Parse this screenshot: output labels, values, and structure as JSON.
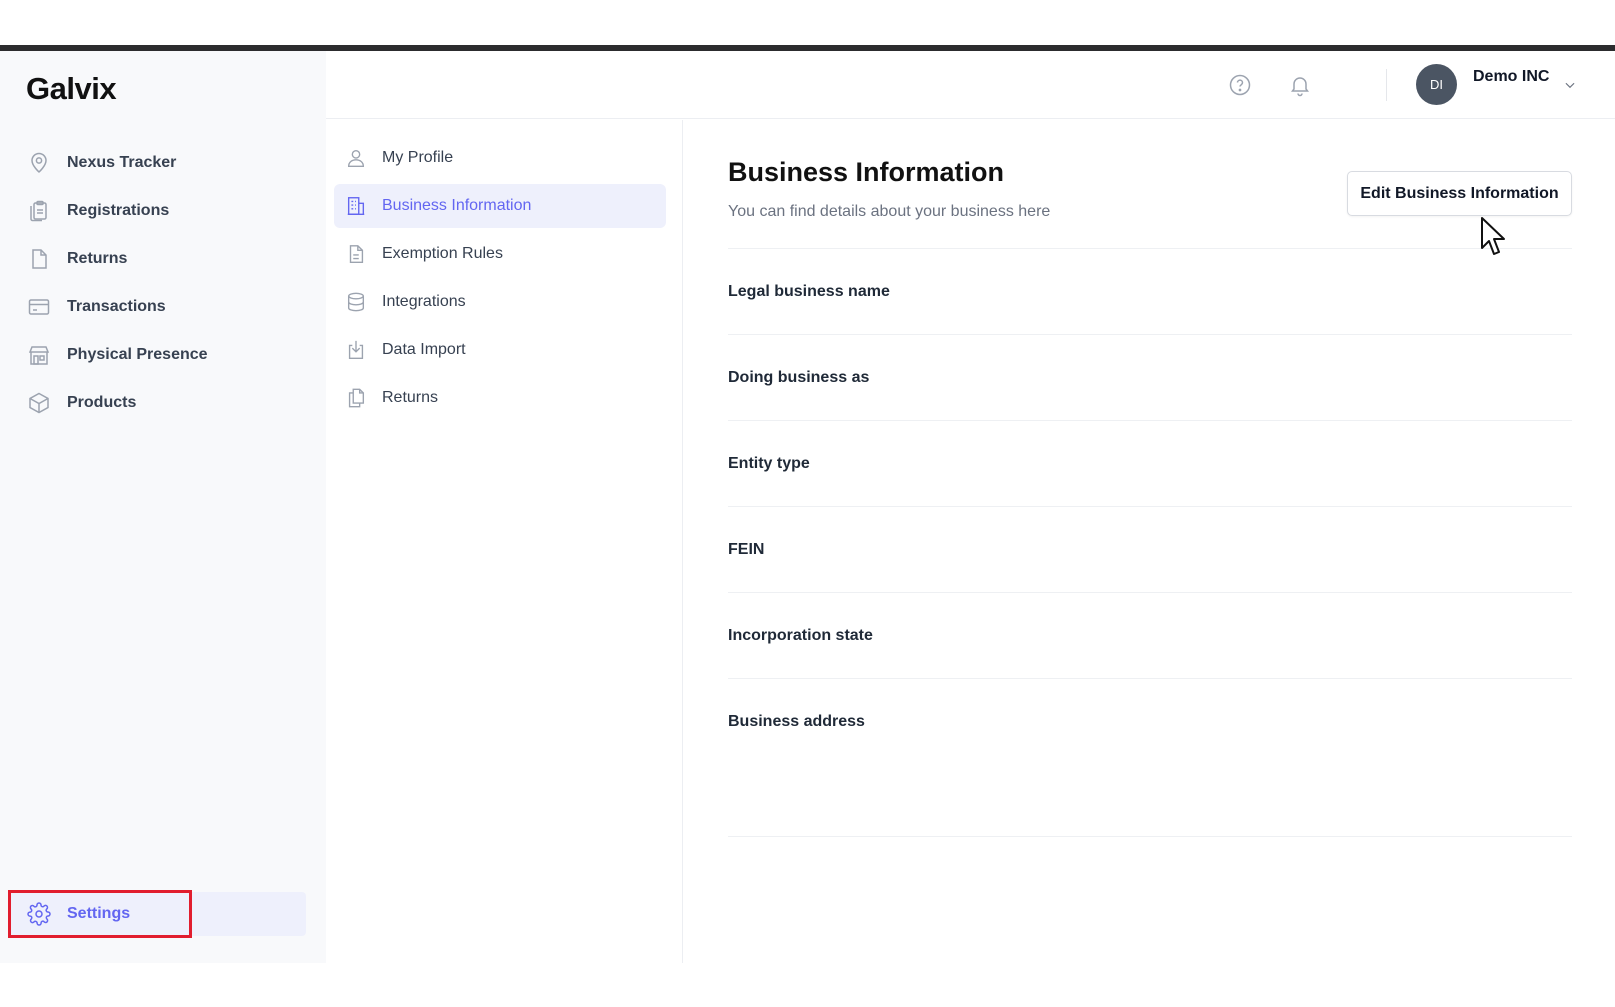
{
  "app": {
    "logo": "Galvix"
  },
  "sidebar": {
    "items": [
      {
        "label": "Nexus Tracker",
        "icon": "map-pin-icon"
      },
      {
        "label": "Registrations",
        "icon": "clipboard-icon"
      },
      {
        "label": "Returns",
        "icon": "document-icon"
      },
      {
        "label": "Transactions",
        "icon": "credit-card-icon"
      },
      {
        "label": "Physical Presence",
        "icon": "building-icon"
      },
      {
        "label": "Products",
        "icon": "box-icon"
      }
    ],
    "settings": {
      "label": "Settings",
      "icon": "gear-icon"
    }
  },
  "header": {
    "help_icon": "help-circle-icon",
    "bell_icon": "bell-icon",
    "avatar_initials": "DI",
    "company_name": "Demo INC"
  },
  "subnav": {
    "items": [
      {
        "label": "My Profile",
        "icon": "user-icon"
      },
      {
        "label": "Business Information",
        "icon": "office-building-icon",
        "active": true
      },
      {
        "label": "Exemption Rules",
        "icon": "file-text-icon"
      },
      {
        "label": "Integrations",
        "icon": "database-icon"
      },
      {
        "label": "Data Import",
        "icon": "import-icon"
      },
      {
        "label": "Returns",
        "icon": "copy-icon"
      }
    ]
  },
  "main": {
    "title": "Business Information",
    "subtitle": "You can find details about your business here",
    "edit_button": "Edit Business Information",
    "fields": [
      {
        "label": "Legal business name",
        "value": ""
      },
      {
        "label": "Doing business as",
        "value": ""
      },
      {
        "label": "Entity type",
        "value": ""
      },
      {
        "label": "FEIN",
        "value": ""
      },
      {
        "label": "Incorporation state",
        "value": ""
      },
      {
        "label": "Business address",
        "value": ""
      }
    ]
  },
  "colors": {
    "accent": "#6366f1",
    "active_bg": "#eef0fc",
    "highlight_box": "#e11d2e",
    "sidebar_bg": "#f8f9fb"
  }
}
